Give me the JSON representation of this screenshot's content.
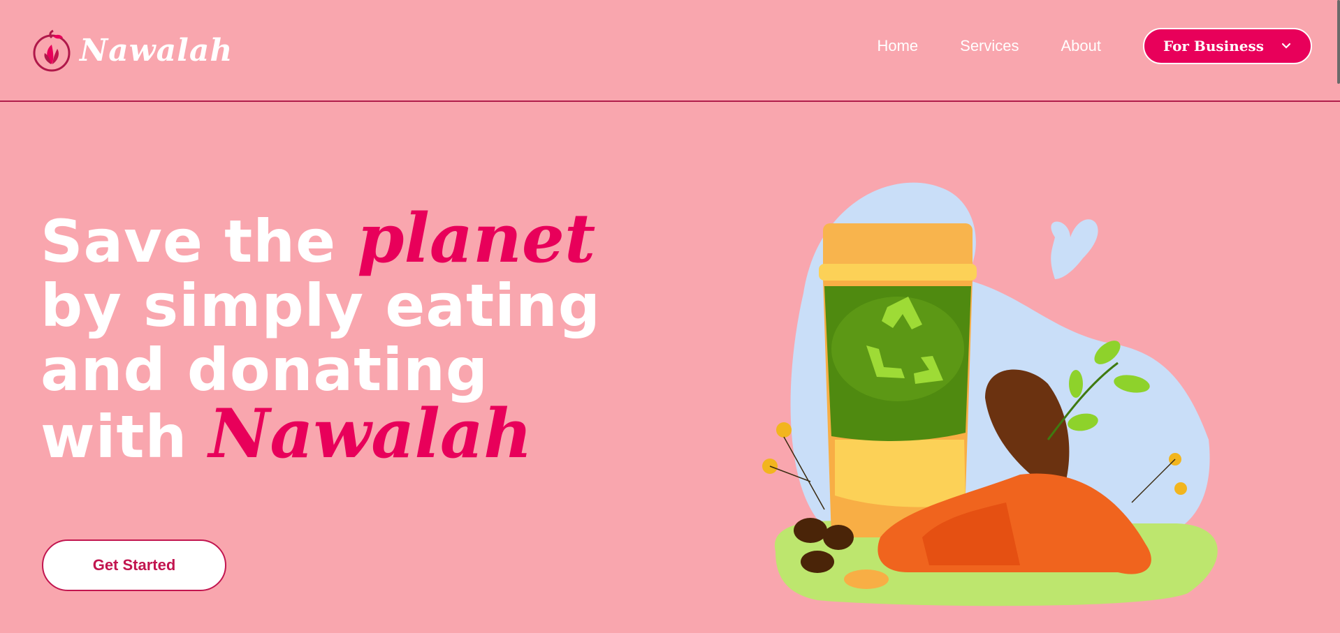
{
  "header": {
    "brand": "Nawalah",
    "nav": [
      {
        "label": "Home"
      },
      {
        "label": "Services"
      },
      {
        "label": "About"
      }
    ],
    "cta_label": "For Business"
  },
  "hero": {
    "title_part1": "Save the ",
    "title_accent1": "planet",
    "title_part2": " by simply eating and donating with ",
    "title_accent2": "Nawalah",
    "button_label": "Get Started"
  },
  "colors": {
    "background": "#f9a6ae",
    "accent": "#e8005a",
    "text": "#ffffff"
  },
  "icons": [
    "logo-icon",
    "chevron-down-icon",
    "illustration-eco-cup"
  ]
}
